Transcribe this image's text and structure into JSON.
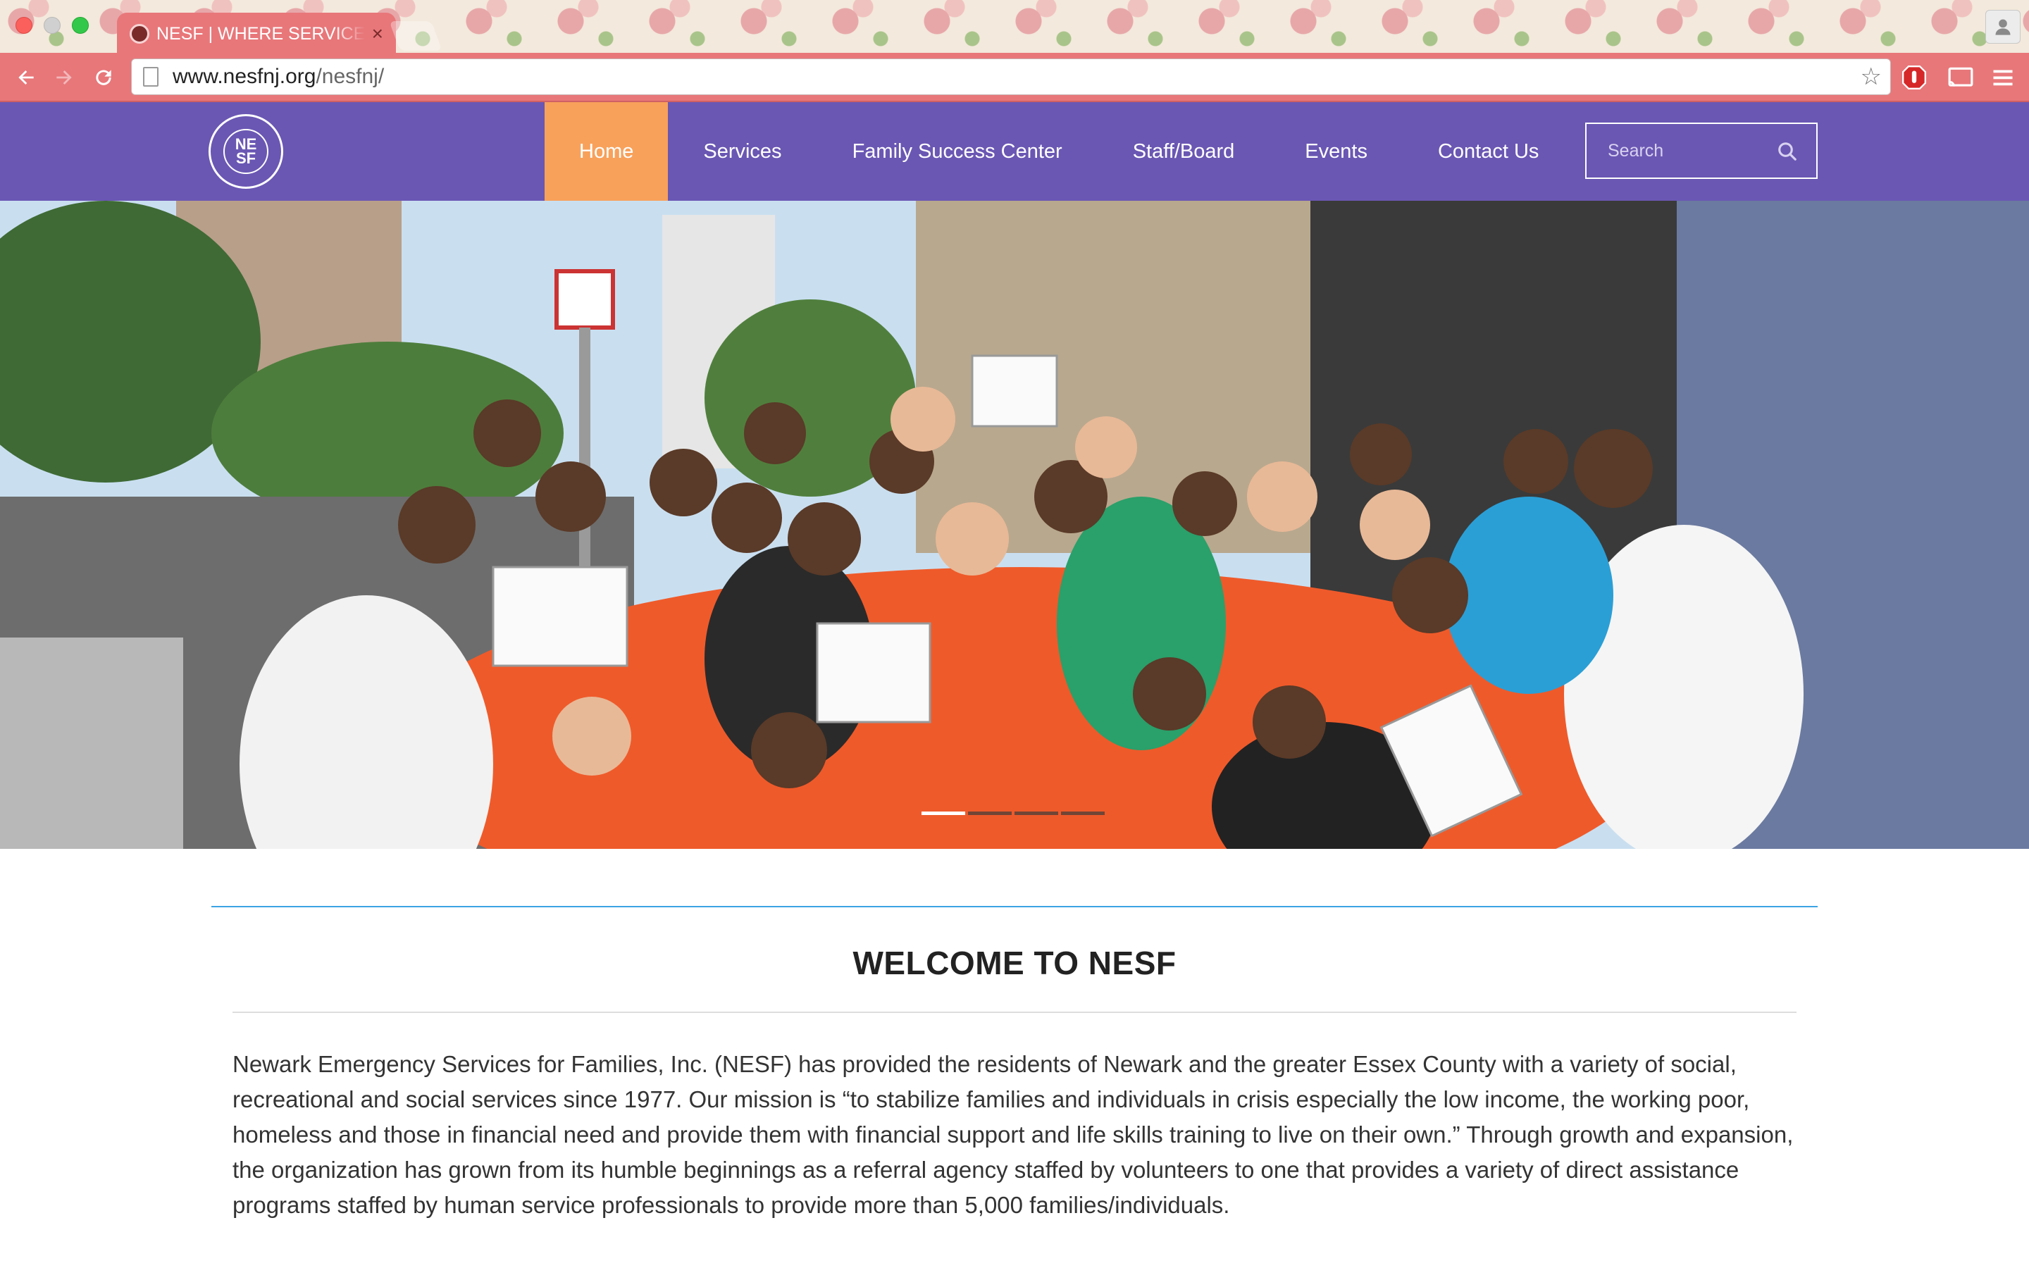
{
  "browser": {
    "tab_title": "NESF | WHERE SERVICE & ",
    "tab_close": "×",
    "url_host": "www.nesfnj.org",
    "url_path": "/nesfnj/",
    "star": "☆"
  },
  "site": {
    "logo_text_line1": "NE",
    "logo_text_line2": "SF",
    "nav": [
      {
        "label": "Home",
        "active": true
      },
      {
        "label": "Services"
      },
      {
        "label": "Family Success Center"
      },
      {
        "label": "Staff/Board"
      },
      {
        "label": "Events"
      },
      {
        "label": "Contact Us"
      }
    ],
    "search_placeholder": "Search"
  },
  "hero": {
    "slides": 4,
    "active_slide": 1
  },
  "content": {
    "heading": "WELCOME TO NESF",
    "intro": "Newark Emergency Services for Families, Inc. (NESF) has provided the residents of Newark and the greater Essex County with a variety of social, recreational and social services since 1977. Our mission is “to stabilize families and individuals in crisis especially the low income, the working poor, homeless and those in financial need and provide them with financial support and life skills training to live on their own.” Through growth and expansion, the organization has grown from its humble beginnings as a referral agency staffed by volunteers to one that provides a variety of direct assistance programs staffed by human service professionals to provide more than 5,000 families/individuals."
  },
  "colors": {
    "nav_bg": "#6a57b3",
    "nav_active": "#f8a15b",
    "divider_blue": "#3aa3e3",
    "browser_toolbar": "#e8777a"
  },
  "icons": {
    "back": "back-arrow-icon",
    "forward": "forward-arrow-icon",
    "reload": "reload-icon",
    "search": "search-icon",
    "profile": "profile-icon"
  }
}
